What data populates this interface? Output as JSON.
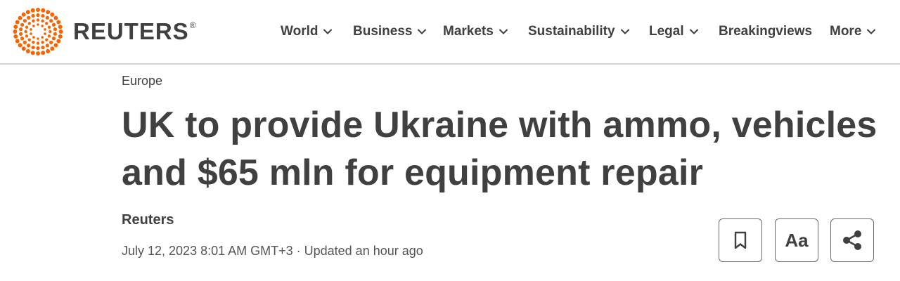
{
  "brand": {
    "name": "REUTERS",
    "registered": "®",
    "accent": "#fa6400"
  },
  "nav": {
    "items": [
      {
        "label": "World",
        "has_dropdown": true
      },
      {
        "label": "Business",
        "has_dropdown": true
      },
      {
        "label": "Markets",
        "has_dropdown": true
      },
      {
        "label": "Sustainability",
        "has_dropdown": true
      },
      {
        "label": "Legal",
        "has_dropdown": true
      },
      {
        "label": "Breakingviews",
        "has_dropdown": false
      },
      {
        "label": "More",
        "has_dropdown": true
      }
    ]
  },
  "article": {
    "section": "Europe",
    "headline": "UK to provide Ukraine with ammo, vehicles and $65 mln for equipment repair",
    "author": "Reuters",
    "dateline": "July 12, 2023 8:01 AM GMT+3 · Updated an hour ago"
  },
  "tools": {
    "bookmark_icon": "bookmark-icon",
    "text_size_label": "Aa",
    "share_icon": "share-icon"
  },
  "colors": {
    "text": "#404040",
    "divider": "#d4d4d4",
    "border": "#6a6a6a"
  }
}
